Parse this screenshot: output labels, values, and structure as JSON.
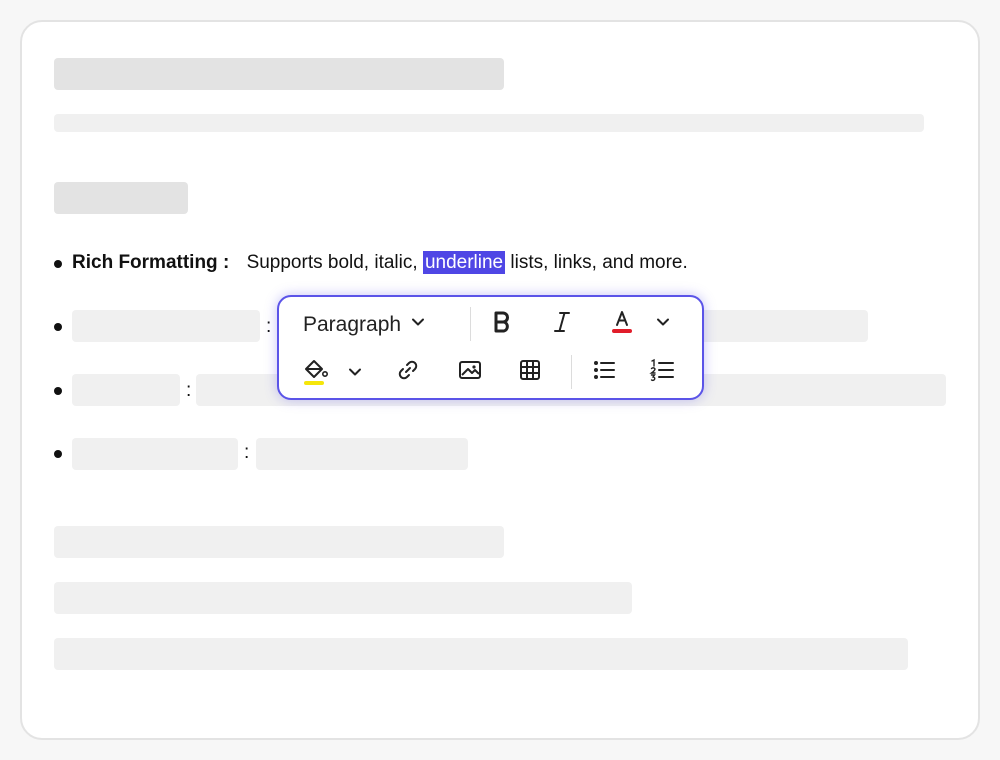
{
  "features": [
    {
      "term": "Rich Formatting",
      "separator": ":",
      "desc_before": "Supports bold, italic, ",
      "highlighted": "underline",
      "desc_after": " lists, links, and more."
    }
  ],
  "placeholder_separators": [
    ":",
    ":",
    ":"
  ],
  "toolbar": {
    "block_format": "Paragraph",
    "icons": {
      "block_format_chevron": "chevron-down-icon",
      "bold": "bold-icon",
      "italic": "italic-icon",
      "text_color": "text-color-icon",
      "text_color_chevron": "chevron-down-icon",
      "highlight": "paint-bucket-icon",
      "highlight_chevron": "chevron-down-icon",
      "link": "link-icon",
      "image": "image-icon",
      "table": "table-icon",
      "bullet_list": "bullet-list-icon",
      "numbered_list": "numbered-list-icon"
    },
    "text_color_swatch": "#e11d2a",
    "highlight_swatch": "#f5e60a"
  },
  "colors": {
    "accent": "#5b54e8",
    "selection": "#4f46e5"
  }
}
